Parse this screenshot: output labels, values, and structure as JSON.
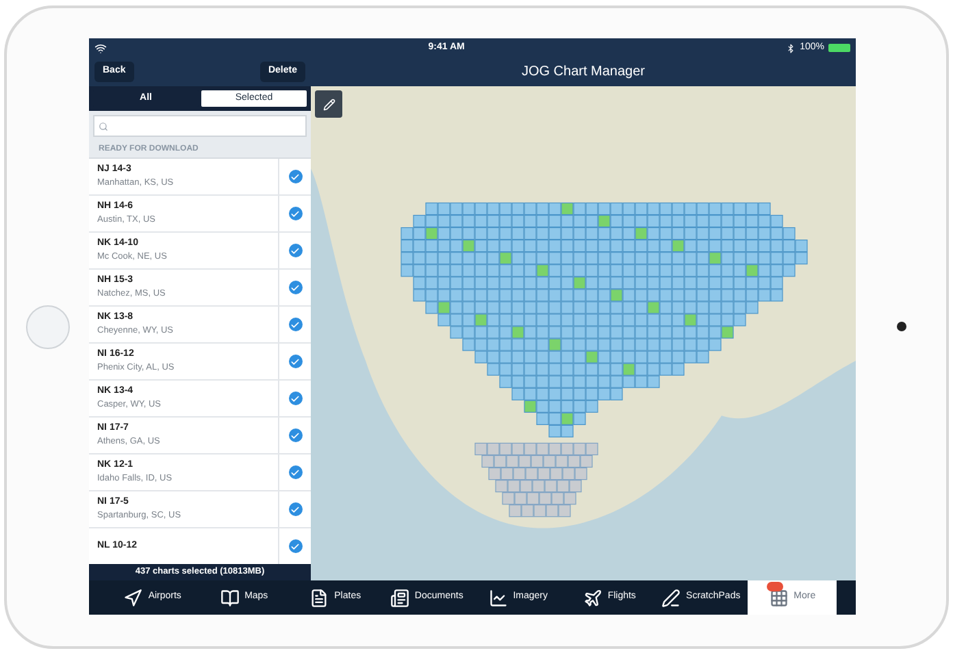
{
  "status_bar": {
    "time": "9:41 AM",
    "battery": "100%"
  },
  "nav": {
    "title": "JOG Chart Manager",
    "back": "Back",
    "delete": "Delete"
  },
  "segments": [
    {
      "label": "All",
      "selected": false
    },
    {
      "label": "Selected",
      "selected": true
    }
  ],
  "section_header": "READY FOR DOWNLOAD",
  "charts": [
    {
      "name": "NJ 14-3",
      "location": "Manhattan, KS, US",
      "checked": true
    },
    {
      "name": "NH 14-6",
      "location": "Austin, TX, US",
      "checked": true
    },
    {
      "name": "NK 14-10",
      "location": "Mc Cook, NE, US",
      "checked": true
    },
    {
      "name": "NH 15-3",
      "location": "Natchez, MS, US",
      "checked": true
    },
    {
      "name": "NK 13-8",
      "location": "Cheyenne, WY, US",
      "checked": true
    },
    {
      "name": "NI 16-12",
      "location": "Phenix City, AL, US",
      "checked": true
    },
    {
      "name": "NK 13-4",
      "location": "Casper, WY, US",
      "checked": true
    },
    {
      "name": "NI 17-7",
      "location": "Athens, GA, US",
      "checked": true
    },
    {
      "name": "NK 12-1",
      "location": "Idaho Falls, ID, US",
      "checked": true
    },
    {
      "name": "NI 17-5",
      "location": "Spartanburg, SC, US",
      "checked": true
    },
    {
      "name": "NL 10-12",
      "checked": true
    }
  ],
  "summary": "437 charts selected (10813MB)",
  "tabs": [
    {
      "kind": "airports",
      "label": "Airports",
      "selected": false
    },
    {
      "kind": "maps",
      "label": "Maps",
      "selected": false
    },
    {
      "kind": "plates",
      "label": "Plates",
      "selected": false
    },
    {
      "kind": "documents",
      "label": "Documents",
      "selected": false
    },
    {
      "kind": "imagery",
      "label": "Imagery",
      "selected": false
    },
    {
      "kind": "flights",
      "label": "Flights",
      "selected": false
    },
    {
      "kind": "scratchpads",
      "label": "ScratchPads",
      "selected": false
    },
    {
      "kind": "more",
      "label": "More",
      "selected": true,
      "badge": true
    }
  ]
}
